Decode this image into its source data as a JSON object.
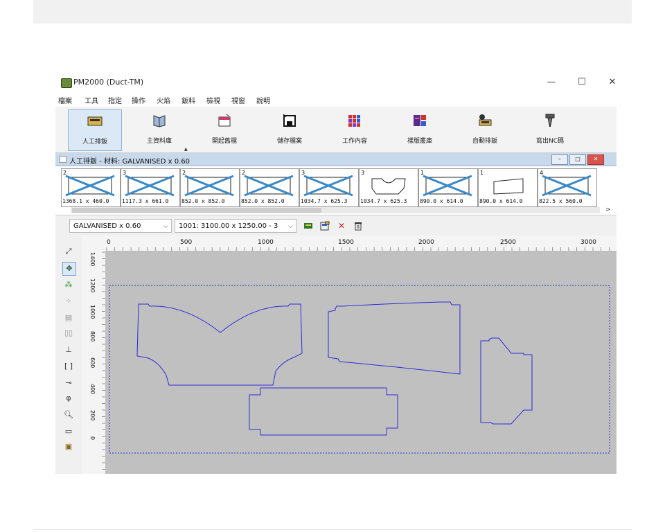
{
  "window": {
    "title": "PM2000 (Duct-TM)",
    "controls": [
      "—",
      "☐",
      "✕"
    ]
  },
  "menu": [
    "檔案",
    "工具",
    "指定",
    "操作",
    "火焰",
    "鈑料",
    "檢視",
    "視窗",
    "說明"
  ],
  "toolbar": [
    {
      "label": "人工排鈑",
      "icon": "manual-nest-icon",
      "active": true
    },
    {
      "label": "主資料庫",
      "icon": "master-database-icon",
      "active": false
    },
    {
      "label": "開起舊檔",
      "icon": "open-file-icon",
      "active": false
    },
    {
      "label": "儲存檔案",
      "icon": "save-file-icon",
      "active": false
    },
    {
      "label": "工作內容",
      "icon": "job-contents-icon",
      "active": false
    },
    {
      "label": "樣版叢庫",
      "icon": "template-library-icon",
      "active": false
    },
    {
      "label": "自動排鈑",
      "icon": "auto-nest-icon",
      "active": false
    },
    {
      "label": "寫出NC碼",
      "icon": "write-nc-icon",
      "active": false
    }
  ],
  "subwindow": {
    "title": "人工排鈑 - 材料: GALVANISED x 0.60"
  },
  "parts": [
    {
      "count": "2",
      "dims": "1368.1 x 460.0",
      "shape": "cross"
    },
    {
      "count": "3",
      "dims": "1117.3 x 661.0",
      "shape": "cross"
    },
    {
      "count": "2",
      "dims": "852.0 x 852.0",
      "shape": "cross"
    },
    {
      "count": "2",
      "dims": "852.0 x 852.0",
      "shape": "cross"
    },
    {
      "count": "3",
      "dims": "1034.7 x 625.3",
      "shape": "cross"
    },
    {
      "count": "3",
      "dims": "1034.7 x 625.3",
      "shape": "outline"
    },
    {
      "count": "1",
      "dims": "890.0 x 614.0",
      "shape": "cross"
    },
    {
      "count": "1",
      "dims": "890.0 x 614.0",
      "shape": "outline"
    },
    {
      "count": "4",
      "dims": "822.5 x 560.0",
      "shape": "cross"
    }
  ],
  "material_select": "GALVANISED x 0.60",
  "sheet_select": "1001: 3100.00 x 1250.00 - 3",
  "ruler": {
    "x_labels": [
      "0",
      "500",
      "1000",
      "1500",
      "2000",
      "2500",
      "3000"
    ],
    "y_labels": [
      "1400",
      "1200",
      "1000",
      "800",
      "600",
      "400",
      "200",
      "0"
    ]
  },
  "colors": {
    "part_outline": "#2b2bd8",
    "sheet_bg": "#c0c0c0",
    "active_tool": "#dbe9f6"
  }
}
